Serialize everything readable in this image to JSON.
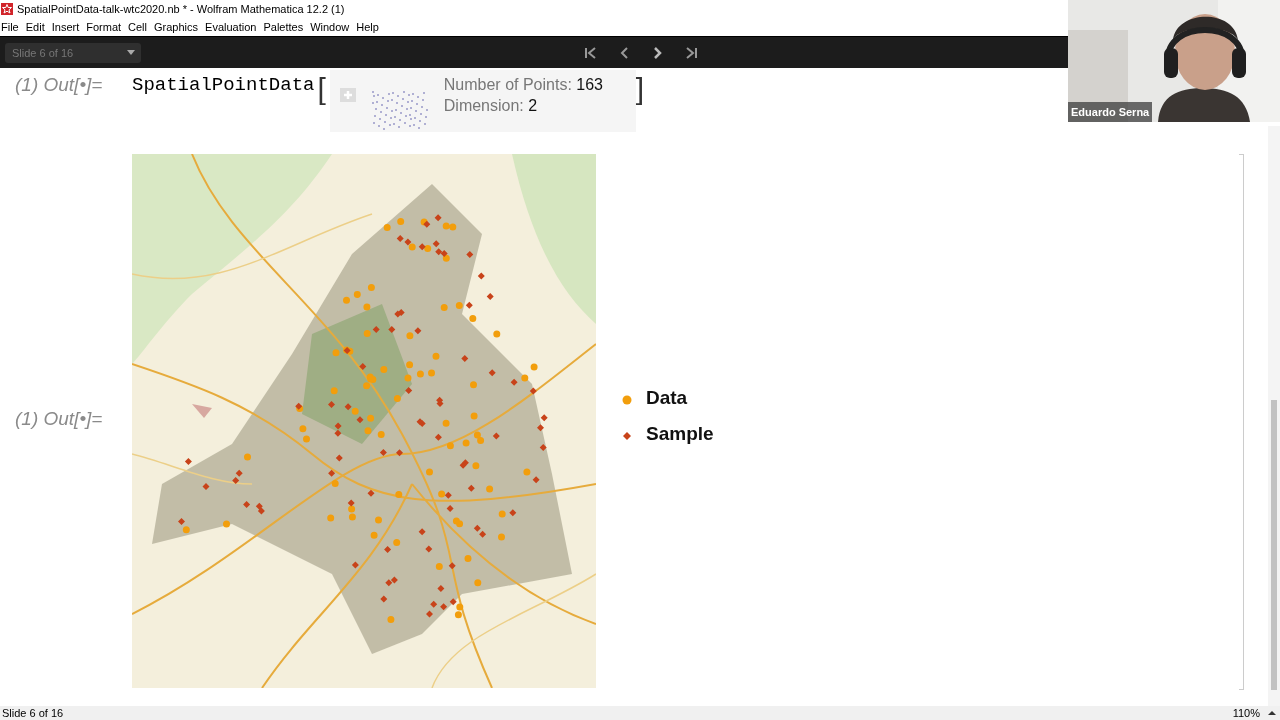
{
  "window": {
    "title": "SpatialPointData-talk-wtc2020.nb * - Wolfram Mathematica 12.2 (1)"
  },
  "menu": [
    "File",
    "Edit",
    "Insert",
    "Format",
    "Cell",
    "Graphics",
    "Evaluation",
    "Palettes",
    "Window",
    "Help"
  ],
  "slide_toolbar": {
    "slide_selector": "Slide 6 of 16"
  },
  "cells": [
    {
      "kind": "summary",
      "label": "(1) Out[•]=",
      "head": "SpatialPointData",
      "open_bracket": "[",
      "close_bracket": "]",
      "fields": [
        {
          "label": "Number of Points:",
          "value": "163"
        },
        {
          "label": "Dimension:",
          "value": "2"
        }
      ]
    },
    {
      "kind": "map_plot",
      "label": "(1) Out[•]=",
      "legend": [
        {
          "label": "Data",
          "kind": "circle",
          "color": "#f29e0c"
        },
        {
          "label": "Sample",
          "kind": "diamond",
          "color": "#c8431a"
        }
      ]
    }
  ],
  "webcam": {
    "name": "Eduardo Serna"
  },
  "status_bar": {
    "slide": "Slide 6 of 16",
    "zoom": "110%"
  }
}
